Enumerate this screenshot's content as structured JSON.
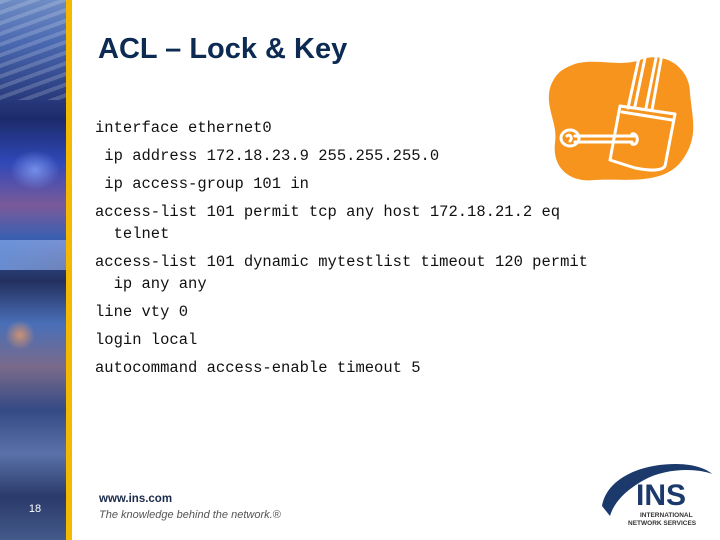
{
  "slide": {
    "title": "ACL – Lock & Key",
    "page_number": "18",
    "code_lines": [
      "interface ethernet0",
      " ip address 172.18.23.9 255.255.255.0",
      " ip access-group 101 in",
      "access-list 101 permit tcp any host 172.18.21.2 eq\n  telnet",
      "access-list 101 dynamic mytestlist timeout 120 permit\n  ip any any",
      "line vty 0",
      "login local",
      "autocommand access-enable timeout 5"
    ]
  },
  "footer": {
    "url": "www.ins.com",
    "tagline": "The knowledge behind the network.®"
  },
  "logo": {
    "name": "INS",
    "line1": "INTERNATIONAL",
    "line2": "NETWORK SERVICES"
  },
  "illustration": {
    "icon": "lock-and-key-icon"
  },
  "colors": {
    "title": "#0d2a52",
    "accent_bar": "#f5b800",
    "illustration_bg": "#f7941d",
    "logo_blue": "#1b3a6b"
  }
}
